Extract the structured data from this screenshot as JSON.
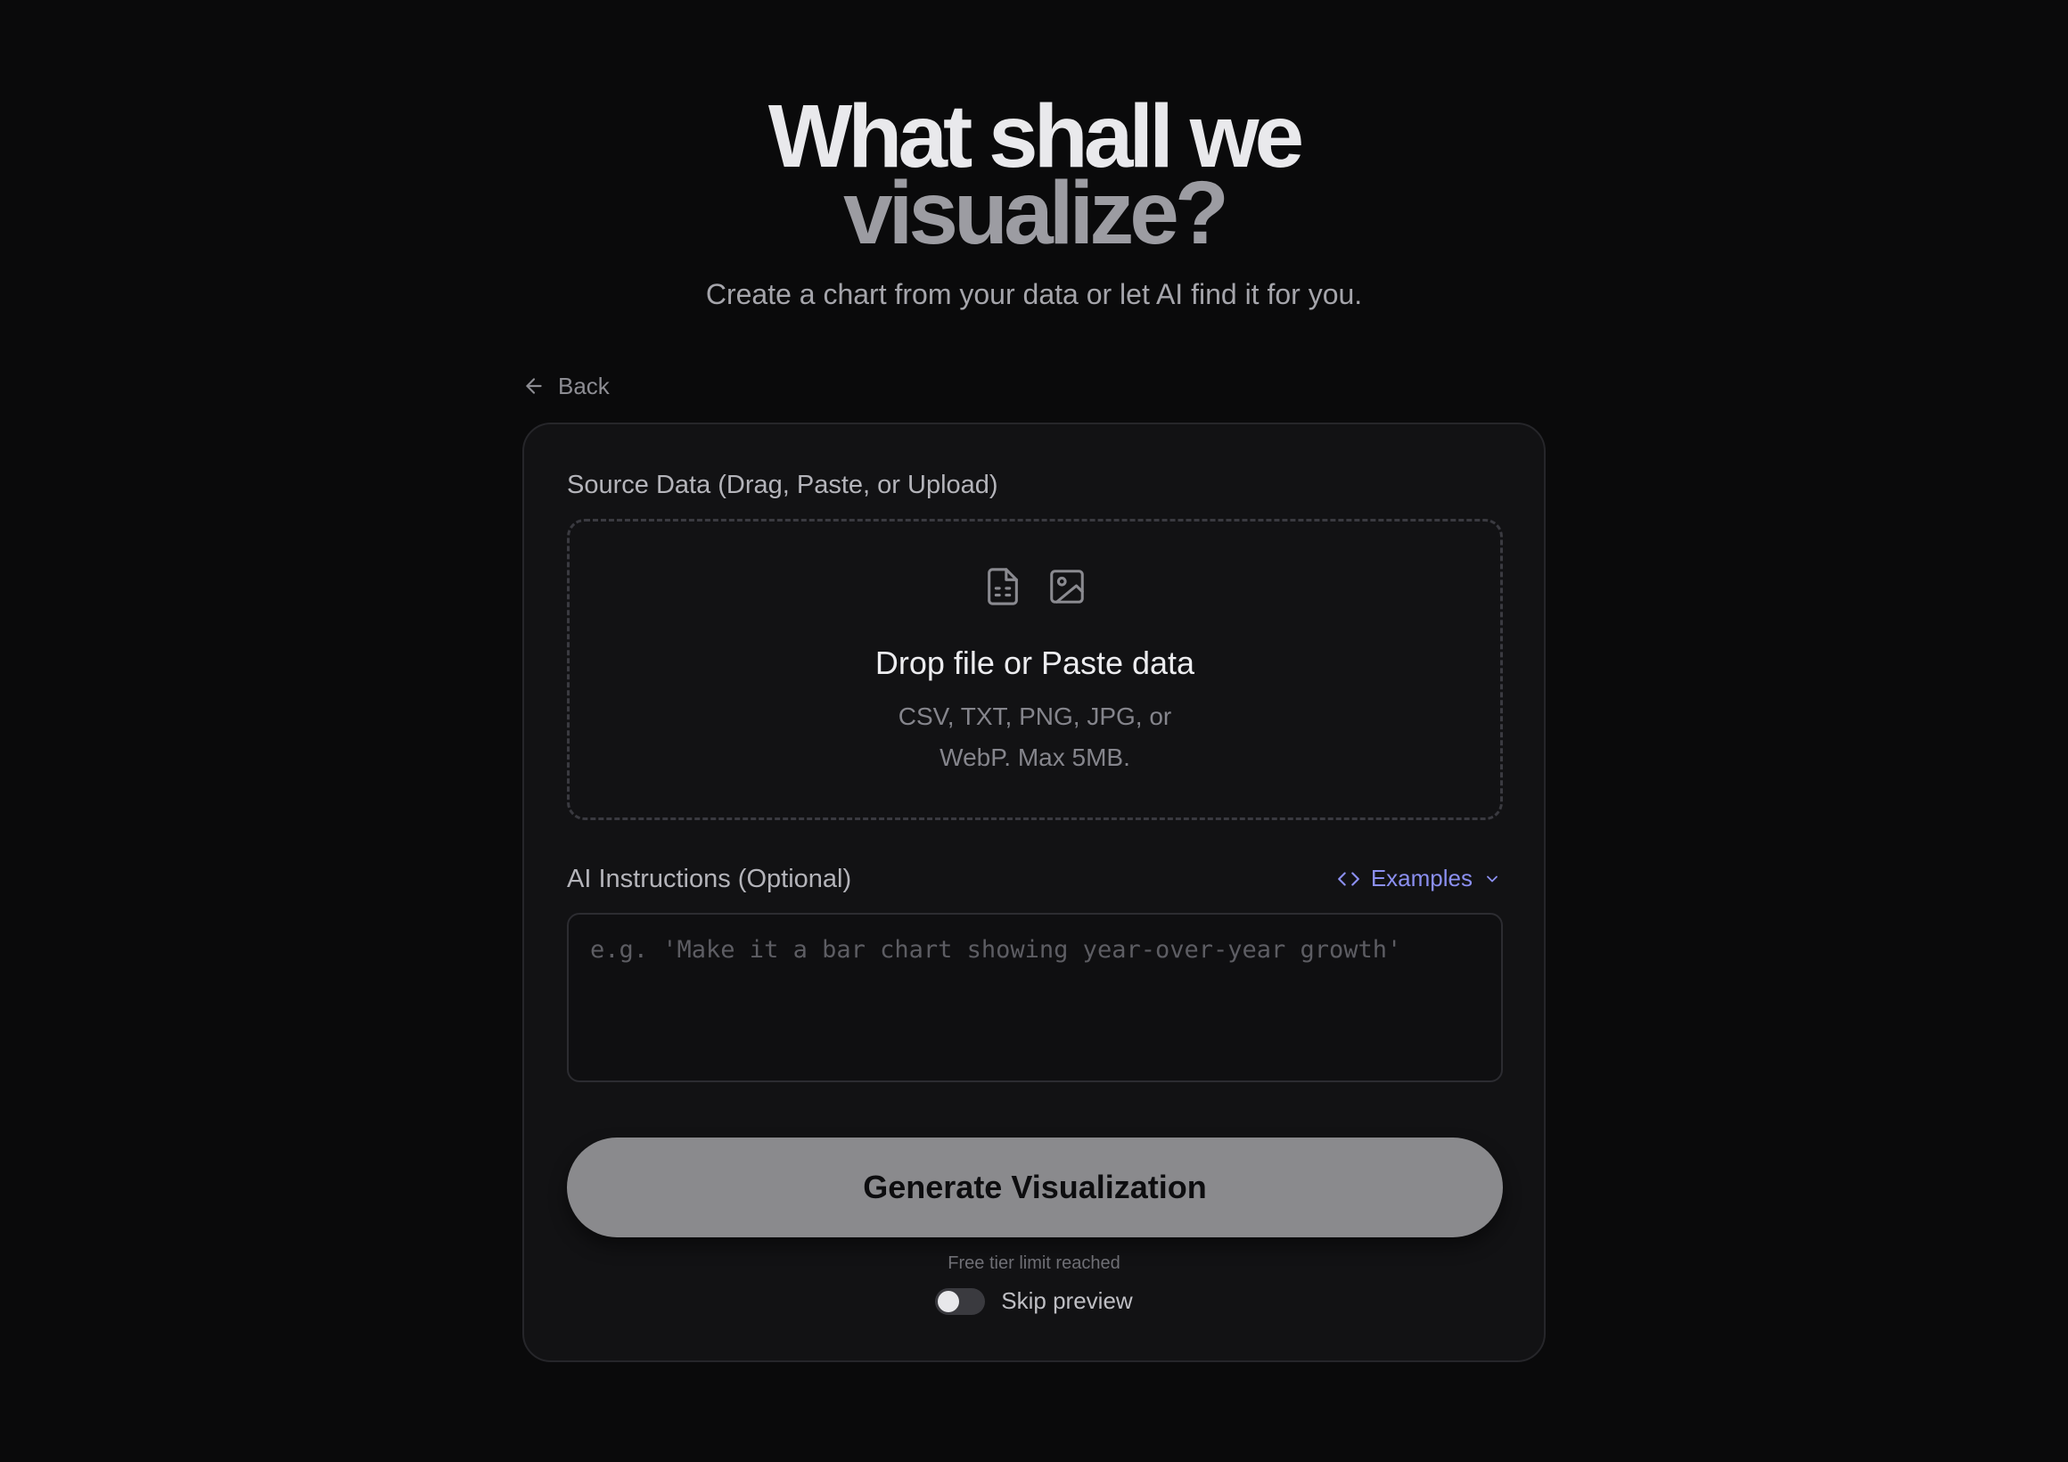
{
  "hero": {
    "title_line1": "What shall we",
    "title_line2": "visualize?",
    "subtitle": "Create a chart from your data or let AI find it for you."
  },
  "nav": {
    "back_label": "Back",
    "back_icon": "arrow-left-icon"
  },
  "source": {
    "label": "Source Data (Drag, Paste, or Upload)",
    "icons": [
      "file-spreadsheet-icon",
      "image-icon"
    ],
    "drop_title": "Drop file or Paste data",
    "drop_hint": "CSV, TXT, PNG, JPG, or WebP. Max 5MB."
  },
  "instructions": {
    "label": "AI Instructions (Optional)",
    "examples_label": "Examples",
    "examples_icon": "code-icon",
    "placeholder": "e.g. 'Make it a bar chart showing year-over-year growth'",
    "value": ""
  },
  "actions": {
    "generate_label": "Generate Visualization",
    "limit_note": "Free tier limit reached",
    "skip_preview_label": "Skip preview",
    "skip_preview_on": false
  },
  "colors": {
    "background": "#0a0a0b",
    "card": "#121214",
    "accent": "#8b8ff0",
    "button": "#8a8a8d"
  }
}
